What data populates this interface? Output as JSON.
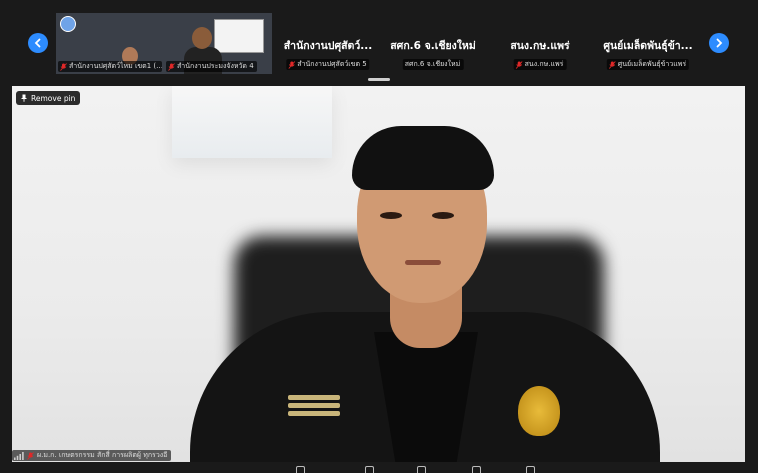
{
  "filmstrip": {
    "tiles": [
      {
        "type": "video",
        "label": "สำนักงานปศุสัตว์ไหม เขต1 (…",
        "thumb": "presentation-slide"
      },
      {
        "type": "video",
        "label": "สำนักงานประมงจังหวัด 4",
        "thumb": "office-man"
      },
      {
        "type": "name",
        "name": "สำนักงานปศุสัตว์...",
        "label": "สำนักงานปศุสัตว์เขต 5"
      },
      {
        "type": "name",
        "name": "สศก.6 จ.เชียงใหม่",
        "label": "สศก.6 จ.เชียงใหม่"
      },
      {
        "type": "name",
        "name": "สนง.กษ.แพร่",
        "label": "สนง.กษ.แพร่"
      },
      {
        "type": "name",
        "name": "ศูนย์เมล็ดพันธุ์ข้า...",
        "label": "ศูนย์เมล็ดพันธุ์ข้าวแพร่"
      }
    ],
    "prev_icon": "chevron-left-icon",
    "next_icon": "chevron-right-icon",
    "nav_color": "#2d8cff"
  },
  "main": {
    "remove_pin_label": "Remove pin",
    "pin_icon": "pin-icon",
    "speaker_label": "ผ.ม.ก. เกษตรกรรม สักสี่ การผลิตผู้ ทุกรวงอี",
    "mic_icon": "mic-muted-icon",
    "signal_icon": "signal-bars-icon"
  },
  "colors": {
    "background": "#1a1a1a",
    "accent": "#2d8cff",
    "muted_mic": "#e02828"
  }
}
